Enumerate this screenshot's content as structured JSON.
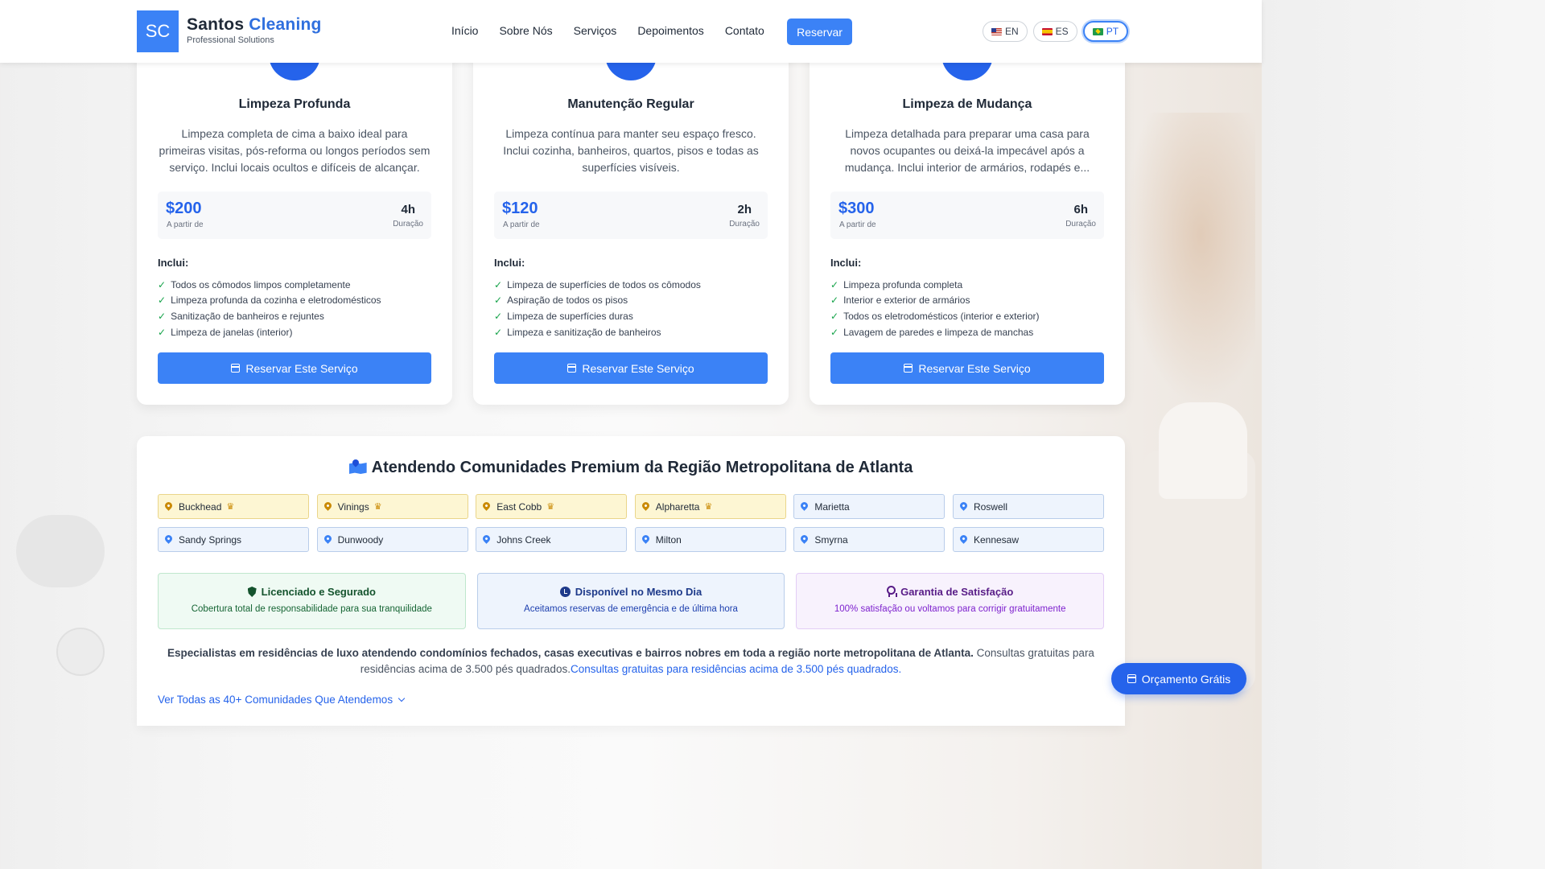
{
  "header": {
    "logo_initials": "SC",
    "brand_name": "Santos",
    "brand_accent": "Cleaning",
    "tagline": "Professional Solutions",
    "nav": [
      "Início",
      "Sobre Nós",
      "Serviços",
      "Depoimentos",
      "Contato"
    ],
    "reserve_label": "Reservar",
    "languages": [
      {
        "code": "EN",
        "flag": "us-flag-icon",
        "active": false
      },
      {
        "code": "ES",
        "flag": "es-flag-icon",
        "active": false
      },
      {
        "code": "PT",
        "flag": "br-flag-icon",
        "active": true
      }
    ]
  },
  "services": [
    {
      "title": "Limpeza Profunda",
      "description": "Limpeza completa de cima a baixo ideal para primeiras visitas, pós-reforma ou longos períodos sem serviço. Inclui locais ocultos e difíceis de alcançar.",
      "price": "$200",
      "price_label": "A partir de",
      "duration": "4h",
      "duration_label": "Duração",
      "includes_title": "Inclui:",
      "includes": [
        "Todos os cômodos limpos completamente",
        "Limpeza profunda da cozinha e eletrodomésticos",
        "Sanitização de banheiros e rejuntes",
        "Limpeza de janelas (interior)"
      ],
      "button": "Reservar Este Serviço"
    },
    {
      "title": "Manutenção Regular",
      "description": "Limpeza contínua para manter seu espaço fresco. Inclui cozinha, banheiros, quartos, pisos e todas as superfícies visíveis.",
      "price": "$120",
      "price_label": "A partir de",
      "duration": "2h",
      "duration_label": "Duração",
      "includes_title": "Inclui:",
      "includes": [
        "Limpeza de superfícies de todos os cômodos",
        "Aspiração de todos os pisos",
        "Limpeza de superfícies duras",
        "Limpeza e sanitização de banheiros"
      ],
      "button": "Reservar Este Serviço"
    },
    {
      "title": "Limpeza de Mudança",
      "description": "Limpeza detalhada para preparar uma casa para novos ocupantes ou deixá-la impecável após a mudança. Inclui interior de armários, rodapés e...",
      "price": "$300",
      "price_label": "A partir de",
      "duration": "6h",
      "duration_label": "Duração",
      "includes_title": "Inclui:",
      "includes": [
        "Limpeza profunda completa",
        "Interior e exterior de armários",
        "Todos os eletrodomésticos (interior e exterior)",
        "Lavagem de paredes e limpeza de manchas"
      ],
      "button": "Reservar Este Serviço"
    }
  ],
  "areas": {
    "title": "Atendendo Comunidades Premium da Região Metropolitana de Atlanta",
    "communities": [
      {
        "name": "Buckhead",
        "premium": true
      },
      {
        "name": "Vinings",
        "premium": true
      },
      {
        "name": "East Cobb",
        "premium": true
      },
      {
        "name": "Alpharetta",
        "premium": true
      },
      {
        "name": "Marietta",
        "premium": false
      },
      {
        "name": "Roswell",
        "premium": false
      },
      {
        "name": "Sandy Springs",
        "premium": false
      },
      {
        "name": "Dunwoody",
        "premium": false
      },
      {
        "name": "Johns Creek",
        "premium": false
      },
      {
        "name": "Milton",
        "premium": false
      },
      {
        "name": "Smyrna",
        "premium": false
      },
      {
        "name": "Kennesaw",
        "premium": false
      }
    ],
    "badges": [
      {
        "title": "Licenciado e Segurado",
        "desc": "Cobertura total de responsabilidade para sua tranquilidade",
        "icon": "shield-icon"
      },
      {
        "title": "Disponível no Mesmo Dia",
        "desc": "Aceitamos reservas de emergência e de última hora",
        "icon": "clock-icon"
      },
      {
        "title": "Garantia de Satisfação",
        "desc": "100% satisfação ou voltamos para corrigir gratuitamente",
        "icon": "award-icon"
      }
    ],
    "blurb_bold": "Especialistas em residências de luxo atendendo condomínios fechados, casas executivas e bairros nobres em toda a região norte metropolitana de Atlanta.",
    "blurb_text": " Consultas gratuitas para residências acima de 3.500 pés quadrados.",
    "blurb_link": "Consultas gratuitas para residências acima de 3.500 pés quadrados.",
    "view_all": "Ver Todas as 40+ Comunidades Que Atendemos"
  },
  "floating_button": "Orçamento Grátis",
  "colors": {
    "primary": "#3b82f6",
    "primary_dark": "#2563eb",
    "premium": "#ca8a04",
    "check": "#16a34a"
  }
}
